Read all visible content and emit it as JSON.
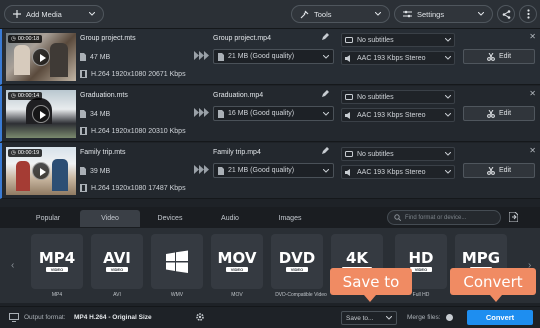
{
  "toolbar": {
    "add_media": "Add Media",
    "tools": "Tools",
    "settings": "Settings"
  },
  "files": [
    {
      "duration": "00:00:18",
      "source_name": "Group project.mts",
      "source_size": "47 MB",
      "source_info": "H.264 1920x1080 20671 Kbps",
      "output_name": "Group project.mp4",
      "output_quality": "21 MB (Good quality)",
      "subtitles": "No subtitles",
      "audio": "AAC 193 Kbps Stereo",
      "edit_label": "Edit"
    },
    {
      "duration": "00:00:14",
      "source_name": "Graduation.mts",
      "source_size": "34 MB",
      "source_info": "H.264 1920x1080 20310 Kbps",
      "output_name": "Graduation.mp4",
      "output_quality": "16 MB (Good quality)",
      "subtitles": "No subtitles",
      "audio": "AAC 193 Kbps Stereo",
      "edit_label": "Edit"
    },
    {
      "duration": "00:00:19",
      "source_name": "Family trip.mts",
      "source_size": "39 MB",
      "source_info": "H.264 1920x1080 17487 Kbps",
      "output_name": "Family trip.mp4",
      "output_quality": "21 MB (Good quality)",
      "subtitles": "No subtitles",
      "audio": "AAC 193 Kbps Stereo",
      "edit_label": "Edit"
    }
  ],
  "tabs": [
    "Popular",
    "Video",
    "Devices",
    "Audio",
    "Images"
  ],
  "active_tab": "Video",
  "search": {
    "placeholder": "Find format or device..."
  },
  "formats": [
    {
      "big": "MP4",
      "small": "VIDEO",
      "label": "MP4"
    },
    {
      "big": "AVI",
      "small": "VIDEO",
      "label": "AVI"
    },
    {
      "big": "",
      "small": "",
      "label": "WMV"
    },
    {
      "big": "MOV",
      "small": "VIDEO",
      "label": "MOV"
    },
    {
      "big": "DVD",
      "small": "VIDEO",
      "label": "DVD-Compatible Video"
    },
    {
      "big": "4K",
      "small": "ULTRA HD",
      "label": "4K"
    },
    {
      "big": "HD",
      "small": "VIDEO",
      "label": "Full HD"
    },
    {
      "big": "MPG",
      "small": "VIDEO",
      "label": "MPG"
    }
  ],
  "bottom": {
    "output_format_label": "Output format:",
    "output_format_value": "MP4 H.264 - Original Size",
    "save_to": "Save to...",
    "merge_files": "Merge files:",
    "convert": "Convert"
  },
  "callouts": {
    "save_to": "Save to",
    "convert": "Convert"
  },
  "colors": {
    "accent_blue": "#1e8ef0",
    "callout_orange": "#f08b63",
    "row_accent": "#3a7bd5"
  }
}
